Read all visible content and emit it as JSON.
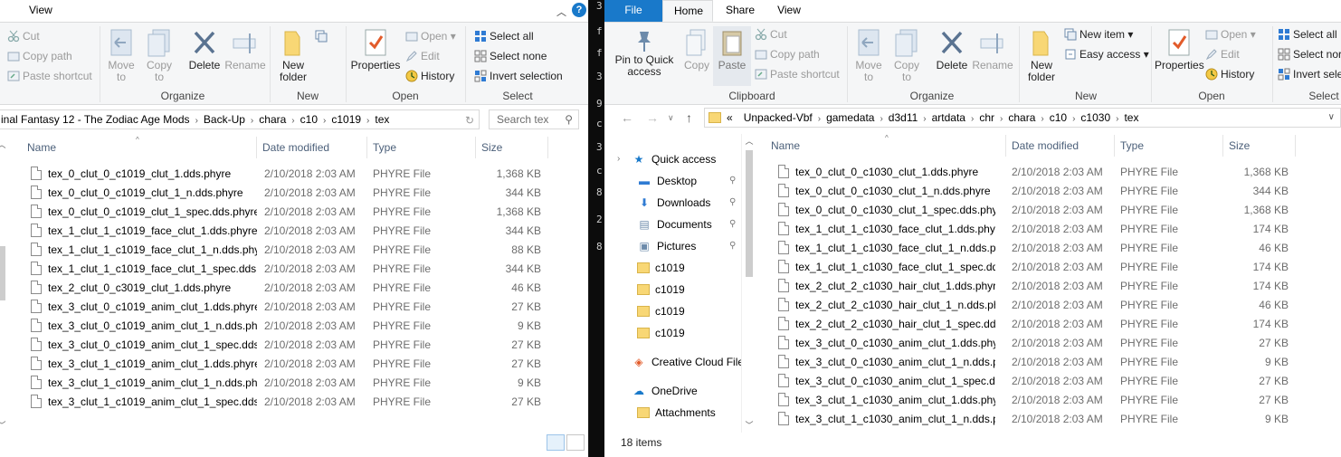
{
  "colors": {
    "file_tab": "#1979ca",
    "ribbon_bg": "#f5f6f7",
    "header_text": "#4c607a"
  },
  "left": {
    "tabs": {
      "view": "View"
    },
    "ribbon": {
      "cut": "Cut",
      "copy_path": "Copy path",
      "paste_shortcut": "Paste shortcut",
      "move_to": "Move to",
      "copy_to": "Copy to",
      "delete": "Delete",
      "rename": "Rename",
      "new_folder": "New folder",
      "properties": "Properties",
      "open": "Open",
      "edit": "Edit",
      "history": "History",
      "select_all": "Select all",
      "select_none": "Select none",
      "invert_selection": "Invert selection",
      "groups": {
        "organize": "Organize",
        "new": "New",
        "open": "Open",
        "select": "Select"
      }
    },
    "address": {
      "crumbs": [
        "inal Fantasy 12 - The Zodiac Age Mods",
        "Back-Up",
        "chara",
        "c10",
        "c1019",
        "tex"
      ]
    },
    "search_placeholder": "Search tex",
    "columns": {
      "name": "Name",
      "date": "Date modified",
      "type": "Type",
      "size": "Size"
    },
    "files": [
      {
        "name": "tex_0_clut_0_c1019_clut_1.dds.phyre",
        "date": "2/10/2018 2:03 AM",
        "type": "PHYRE File",
        "size": "1,368 KB"
      },
      {
        "name": "tex_0_clut_0_c1019_clut_1_n.dds.phyre",
        "date": "2/10/2018 2:03 AM",
        "type": "PHYRE File",
        "size": "344 KB"
      },
      {
        "name": "tex_0_clut_0_c1019_clut_1_spec.dds.phyre",
        "date": "2/10/2018 2:03 AM",
        "type": "PHYRE File",
        "size": "1,368 KB"
      },
      {
        "name": "tex_1_clut_1_c1019_face_clut_1.dds.phyre",
        "date": "2/10/2018 2:03 AM",
        "type": "PHYRE File",
        "size": "344 KB"
      },
      {
        "name": "tex_1_clut_1_c1019_face_clut_1_n.dds.phy...",
        "date": "2/10/2018 2:03 AM",
        "type": "PHYRE File",
        "size": "88 KB"
      },
      {
        "name": "tex_1_clut_1_c1019_face_clut_1_spec.dds....",
        "date": "2/10/2018 2:03 AM",
        "type": "PHYRE File",
        "size": "344 KB"
      },
      {
        "name": "tex_2_clut_0_c3019_clut_1.dds.phyre",
        "date": "2/10/2018 2:03 AM",
        "type": "PHYRE File",
        "size": "46 KB"
      },
      {
        "name": "tex_3_clut_0_c1019_anim_clut_1.dds.phyre",
        "date": "2/10/2018 2:03 AM",
        "type": "PHYRE File",
        "size": "27 KB"
      },
      {
        "name": "tex_3_clut_0_c1019_anim_clut_1_n.dds.ph...",
        "date": "2/10/2018 2:03 AM",
        "type": "PHYRE File",
        "size": "9 KB"
      },
      {
        "name": "tex_3_clut_0_c1019_anim_clut_1_spec.dds....",
        "date": "2/10/2018 2:03 AM",
        "type": "PHYRE File",
        "size": "27 KB"
      },
      {
        "name": "tex_3_clut_1_c1019_anim_clut_1.dds.phyre",
        "date": "2/10/2018 2:03 AM",
        "type": "PHYRE File",
        "size": "27 KB"
      },
      {
        "name": "tex_3_clut_1_c1019_anim_clut_1_n.dds.phyre",
        "date": "2/10/2018 2:03 AM",
        "type": "PHYRE File",
        "size": "9 KB"
      },
      {
        "name": "tex_3_clut_1_c1019_anim_clut_1_spec.dds....",
        "date": "2/10/2018 2:03 AM",
        "type": "PHYRE File",
        "size": "27 KB"
      }
    ]
  },
  "right": {
    "tabs": {
      "file": "File",
      "home": "Home",
      "share": "Share",
      "view": "View"
    },
    "ribbon": {
      "pin": "Pin to Quick access",
      "copy": "Copy",
      "paste": "Paste",
      "cut": "Cut",
      "copy_path": "Copy path",
      "paste_shortcut": "Paste shortcut",
      "move_to": "Move to",
      "copy_to": "Copy to",
      "delete": "Delete",
      "rename": "Rename",
      "new_folder": "New folder",
      "new_item": "New item",
      "easy_access": "Easy access",
      "properties": "Properties",
      "open": "Open",
      "edit": "Edit",
      "history": "History",
      "select_all": "Select all",
      "select_none": "Select nor",
      "invert_selection": "Invert sele",
      "groups": {
        "clipboard": "Clipboard",
        "organize": "Organize",
        "new": "New",
        "open": "Open",
        "select": "Select"
      }
    },
    "address": {
      "prefix": "«",
      "crumbs": [
        "Unpacked-Vbf",
        "gamedata",
        "d3d11",
        "artdata",
        "chr",
        "chara",
        "c10",
        "c1030",
        "tex"
      ]
    },
    "nav": [
      {
        "label": "Quick access",
        "icon": "star-icon"
      },
      {
        "label": "Desktop",
        "icon": "desktop-icon"
      },
      {
        "label": "Downloads",
        "icon": "download-icon"
      },
      {
        "label": "Documents",
        "icon": "documents-icon"
      },
      {
        "label": "Pictures",
        "icon": "pictures-icon"
      },
      {
        "label": "c1019",
        "icon": "folder-icon"
      },
      {
        "label": "c1019",
        "icon": "folder-icon"
      },
      {
        "label": "c1019",
        "icon": "folder-icon"
      },
      {
        "label": "c1019",
        "icon": "folder-icon"
      },
      {
        "label": "Creative Cloud Files",
        "icon": "creative-cloud-icon"
      },
      {
        "label": "OneDrive",
        "icon": "onedrive-icon"
      },
      {
        "label": "Attachments",
        "icon": "folder-icon"
      }
    ],
    "columns": {
      "name": "Name",
      "date": "Date modified",
      "type": "Type",
      "size": "Size"
    },
    "files": [
      {
        "name": "tex_0_clut_0_c1030_clut_1.dds.phyre",
        "date": "2/10/2018 2:03 AM",
        "type": "PHYRE File",
        "size": "1,368 KB"
      },
      {
        "name": "tex_0_clut_0_c1030_clut_1_n.dds.phyre",
        "date": "2/10/2018 2:03 AM",
        "type": "PHYRE File",
        "size": "344 KB"
      },
      {
        "name": "tex_0_clut_0_c1030_clut_1_spec.dds.phyre",
        "date": "2/10/2018 2:03 AM",
        "type": "PHYRE File",
        "size": "1,368 KB"
      },
      {
        "name": "tex_1_clut_1_c1030_face_clut_1.dds.phyre",
        "date": "2/10/2018 2:03 AM",
        "type": "PHYRE File",
        "size": "174 KB"
      },
      {
        "name": "tex_1_clut_1_c1030_face_clut_1_n.dds.phy...",
        "date": "2/10/2018 2:03 AM",
        "type": "PHYRE File",
        "size": "46 KB"
      },
      {
        "name": "tex_1_clut_1_c1030_face_clut_1_spec.dds....",
        "date": "2/10/2018 2:03 AM",
        "type": "PHYRE File",
        "size": "174 KB"
      },
      {
        "name": "tex_2_clut_2_c1030_hair_clut_1.dds.phyre",
        "date": "2/10/2018 2:03 AM",
        "type": "PHYRE File",
        "size": "174 KB"
      },
      {
        "name": "tex_2_clut_2_c1030_hair_clut_1_n.dds.phyre",
        "date": "2/10/2018 2:03 AM",
        "type": "PHYRE File",
        "size": "46 KB"
      },
      {
        "name": "tex_2_clut_2_c1030_hair_clut_1_spec.dds....",
        "date": "2/10/2018 2:03 AM",
        "type": "PHYRE File",
        "size": "174 KB"
      },
      {
        "name": "tex_3_clut_0_c1030_anim_clut_1.dds.phyre",
        "date": "2/10/2018 2:03 AM",
        "type": "PHYRE File",
        "size": "27 KB"
      },
      {
        "name": "tex_3_clut_0_c1030_anim_clut_1_n.dds.phyre",
        "date": "2/10/2018 2:03 AM",
        "type": "PHYRE File",
        "size": "9 KB"
      },
      {
        "name": "tex_3_clut_0_c1030_anim_clut_1_spec.dds....",
        "date": "2/10/2018 2:03 AM",
        "type": "PHYRE File",
        "size": "27 KB"
      },
      {
        "name": "tex_3_clut_1_c1030_anim_clut_1.dds.phyre",
        "date": "2/10/2018 2:03 AM",
        "type": "PHYRE File",
        "size": "27 KB"
      },
      {
        "name": "tex_3_clut_1_c1030_anim_clut_1_n.dds.phy...",
        "date": "2/10/2018 2:03 AM",
        "type": "PHYRE File",
        "size": "9 KB"
      }
    ],
    "status": "18 items"
  },
  "console": {
    "chars": [
      "3",
      "f",
      "f",
      "3",
      "9",
      "c",
      "3",
      "c",
      "8",
      "2",
      "8"
    ]
  }
}
